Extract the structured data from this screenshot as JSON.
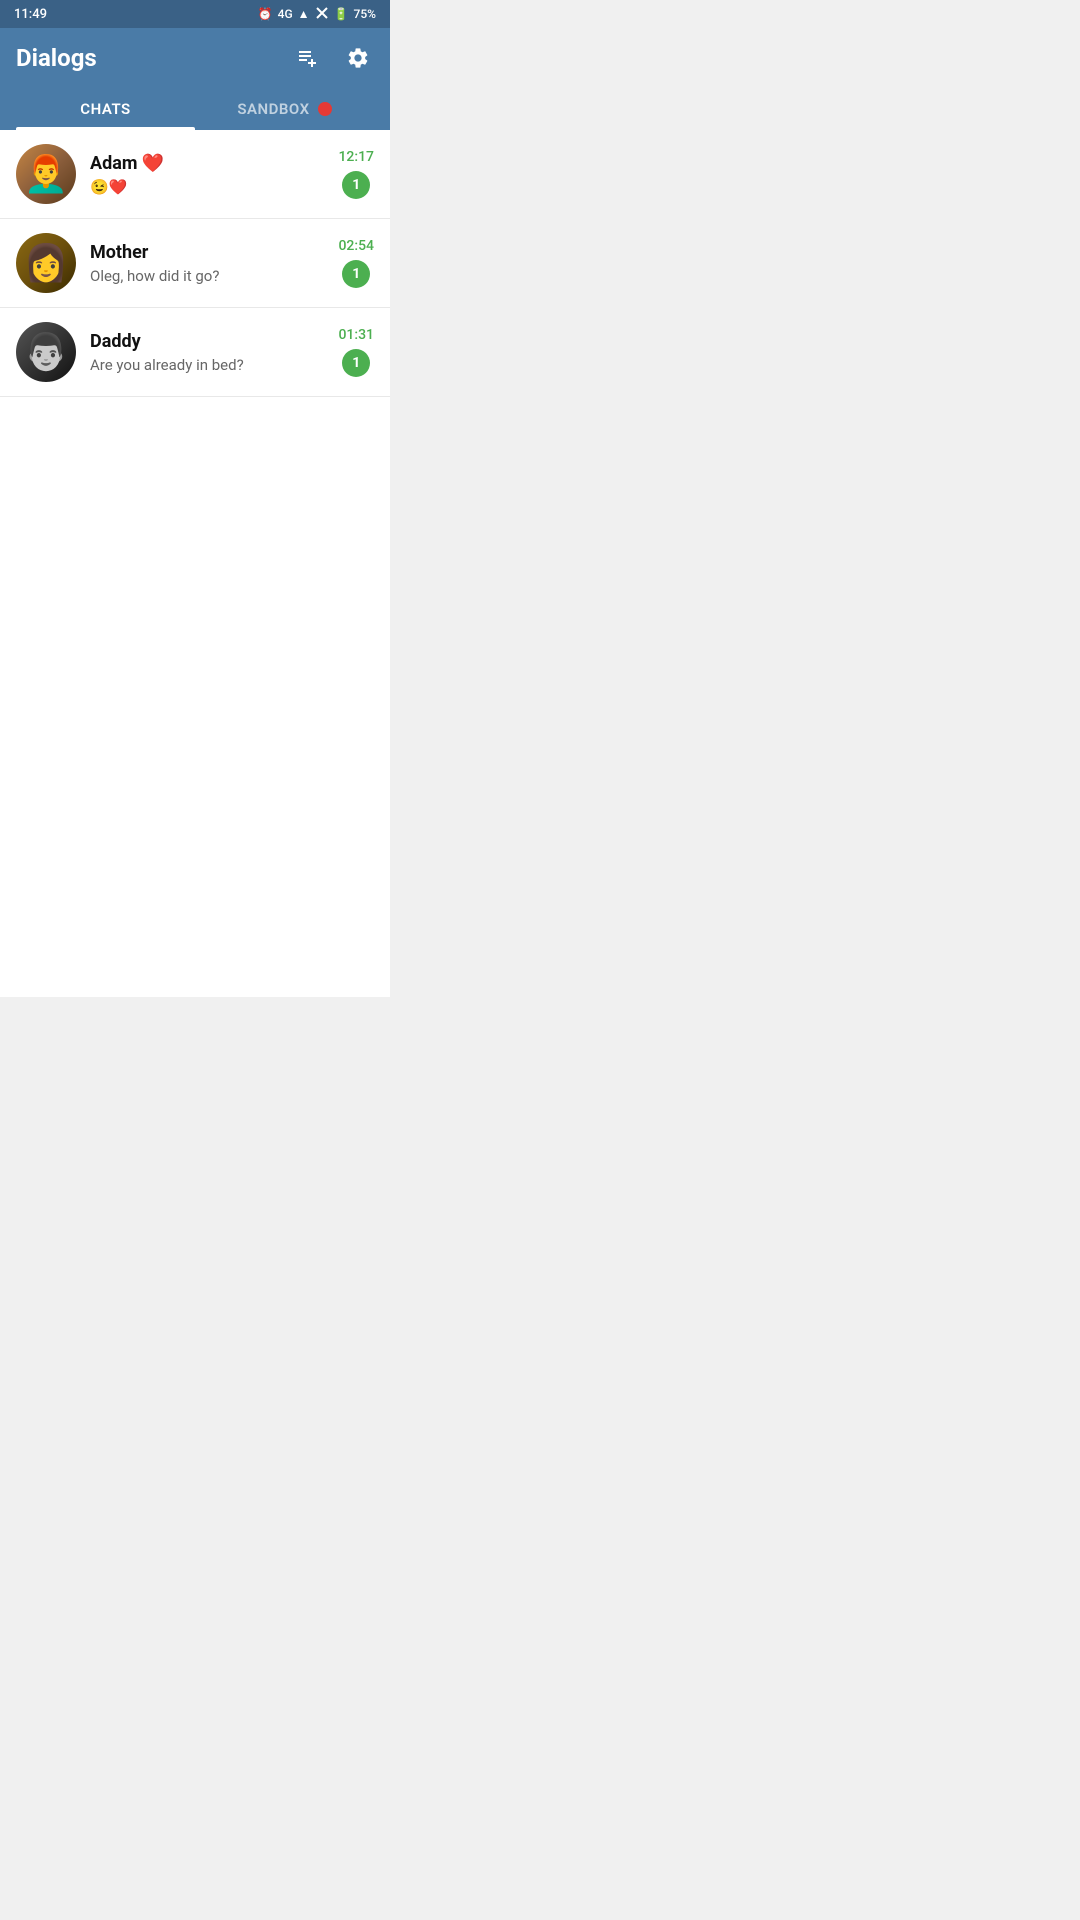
{
  "statusBar": {
    "time": "11:49",
    "batteryPercent": "75%",
    "signal": "4G"
  },
  "header": {
    "title": "Dialogs",
    "addButton": "add-chat",
    "settingsButton": "settings"
  },
  "tabs": [
    {
      "id": "chats",
      "label": "CHATS",
      "active": true
    },
    {
      "id": "sandbox",
      "label": "SANDBOX",
      "active": false,
      "hasDot": true
    }
  ],
  "chats": [
    {
      "id": "adam",
      "name": "Adam",
      "nameEmoji": "❤️",
      "preview": "😉❤️",
      "time": "12:17",
      "unread": "1"
    },
    {
      "id": "mother",
      "name": "Mother",
      "nameEmoji": "",
      "preview": "Oleg, how did it go?",
      "time": "02:54",
      "unread": "1"
    },
    {
      "id": "daddy",
      "name": "Daddy",
      "nameEmoji": "",
      "preview": "Are you already in bed?",
      "time": "01:31",
      "unread": "1"
    }
  ]
}
